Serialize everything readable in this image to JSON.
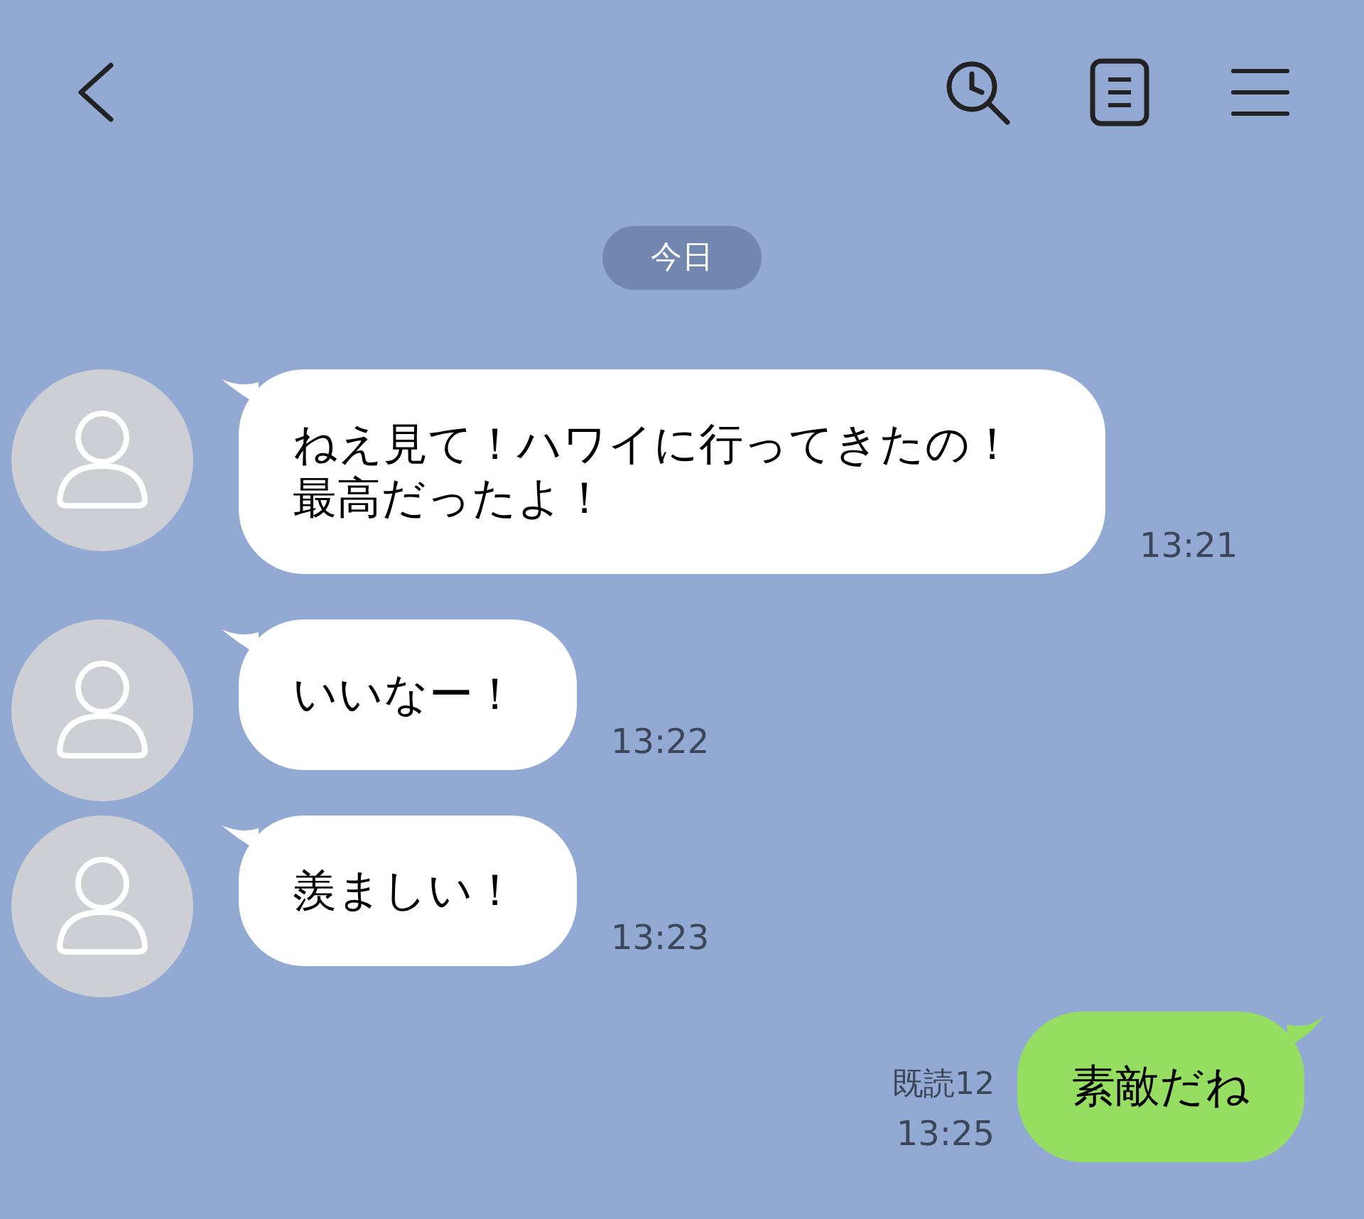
{
  "date_label": "今日",
  "messages": [
    {
      "kind": "incoming",
      "text": "ねえ見て！ハワイに行ってきたの！最高だったよ！",
      "time": "13:21"
    },
    {
      "kind": "incoming",
      "text": "いいなー！",
      "time": "13:22"
    },
    {
      "kind": "incoming",
      "text": "羨ましい！",
      "time": "13:23"
    },
    {
      "kind": "outgoing",
      "text": "素敵だね",
      "time": "13:25",
      "read": "既読12"
    }
  ]
}
